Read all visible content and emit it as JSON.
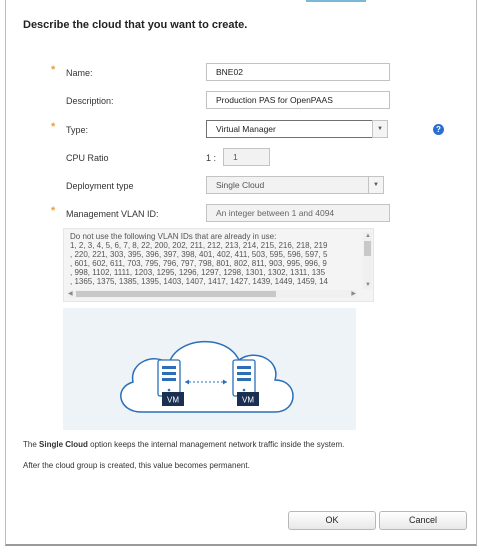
{
  "dialog": {
    "title": "Describe the cloud that you want to create."
  },
  "form": {
    "name_label": "Name:",
    "name_value": "BNE02",
    "description_label": "Description:",
    "description_value": "Production PAS for OpenPAAS",
    "type_label": "Type:",
    "type_value": "Virtual Manager",
    "cpu_ratio_label": "CPU Ratio",
    "cpu_ratio_prefix": "1 :",
    "cpu_ratio_value": "1",
    "deployment_label": "Deployment type",
    "deployment_value": "Single Cloud",
    "vlan_label": "Management VLAN ID:",
    "vlan_placeholder": "An integer between 1 and 4094",
    "required_marker": "*",
    "help_glyph": "?"
  },
  "vlan_list": {
    "heading": "Do not use the following VLAN IDs that are already in use:",
    "lines": [
      "1, 2, 3, 4, 5, 6, 7, 8, 22, 200, 202, 211, 212, 213, 214, 215, 216, 218, 219",
      ", 220, 221, 303, 395, 396, 397, 398, 401, 402, 411, 503, 595, 596, 597, 5",
      ", 601, 602, 611, 703, 795, 796, 797, 798, 801, 802, 811, 903, 995, 996, 9",
      ", 998, 1102, 1111, 1203, 1295, 1296, 1297, 1298, 1301, 1302, 1311, 135",
      ", 1365, 1375, 1385, 1395, 1403, 1407, 1417, 1427, 1439, 1449, 1459, 14"
    ]
  },
  "illustration": {
    "vm_left_label": "VM",
    "vm_right_label": "VM",
    "cloud_color": "#2a6fb8",
    "server_color": "#2a6fb8"
  },
  "info": {
    "line1_prefix": "The ",
    "line1_bold": "Single Cloud",
    "line1_suffix": " option keeps the internal management network traffic inside the system.",
    "line2": "After the cloud group is created, this value becomes permanent."
  },
  "buttons": {
    "ok": "OK",
    "cancel": "Cancel"
  },
  "colors": {
    "required": "#e8a13a",
    "help": "#2a6fd0"
  }
}
